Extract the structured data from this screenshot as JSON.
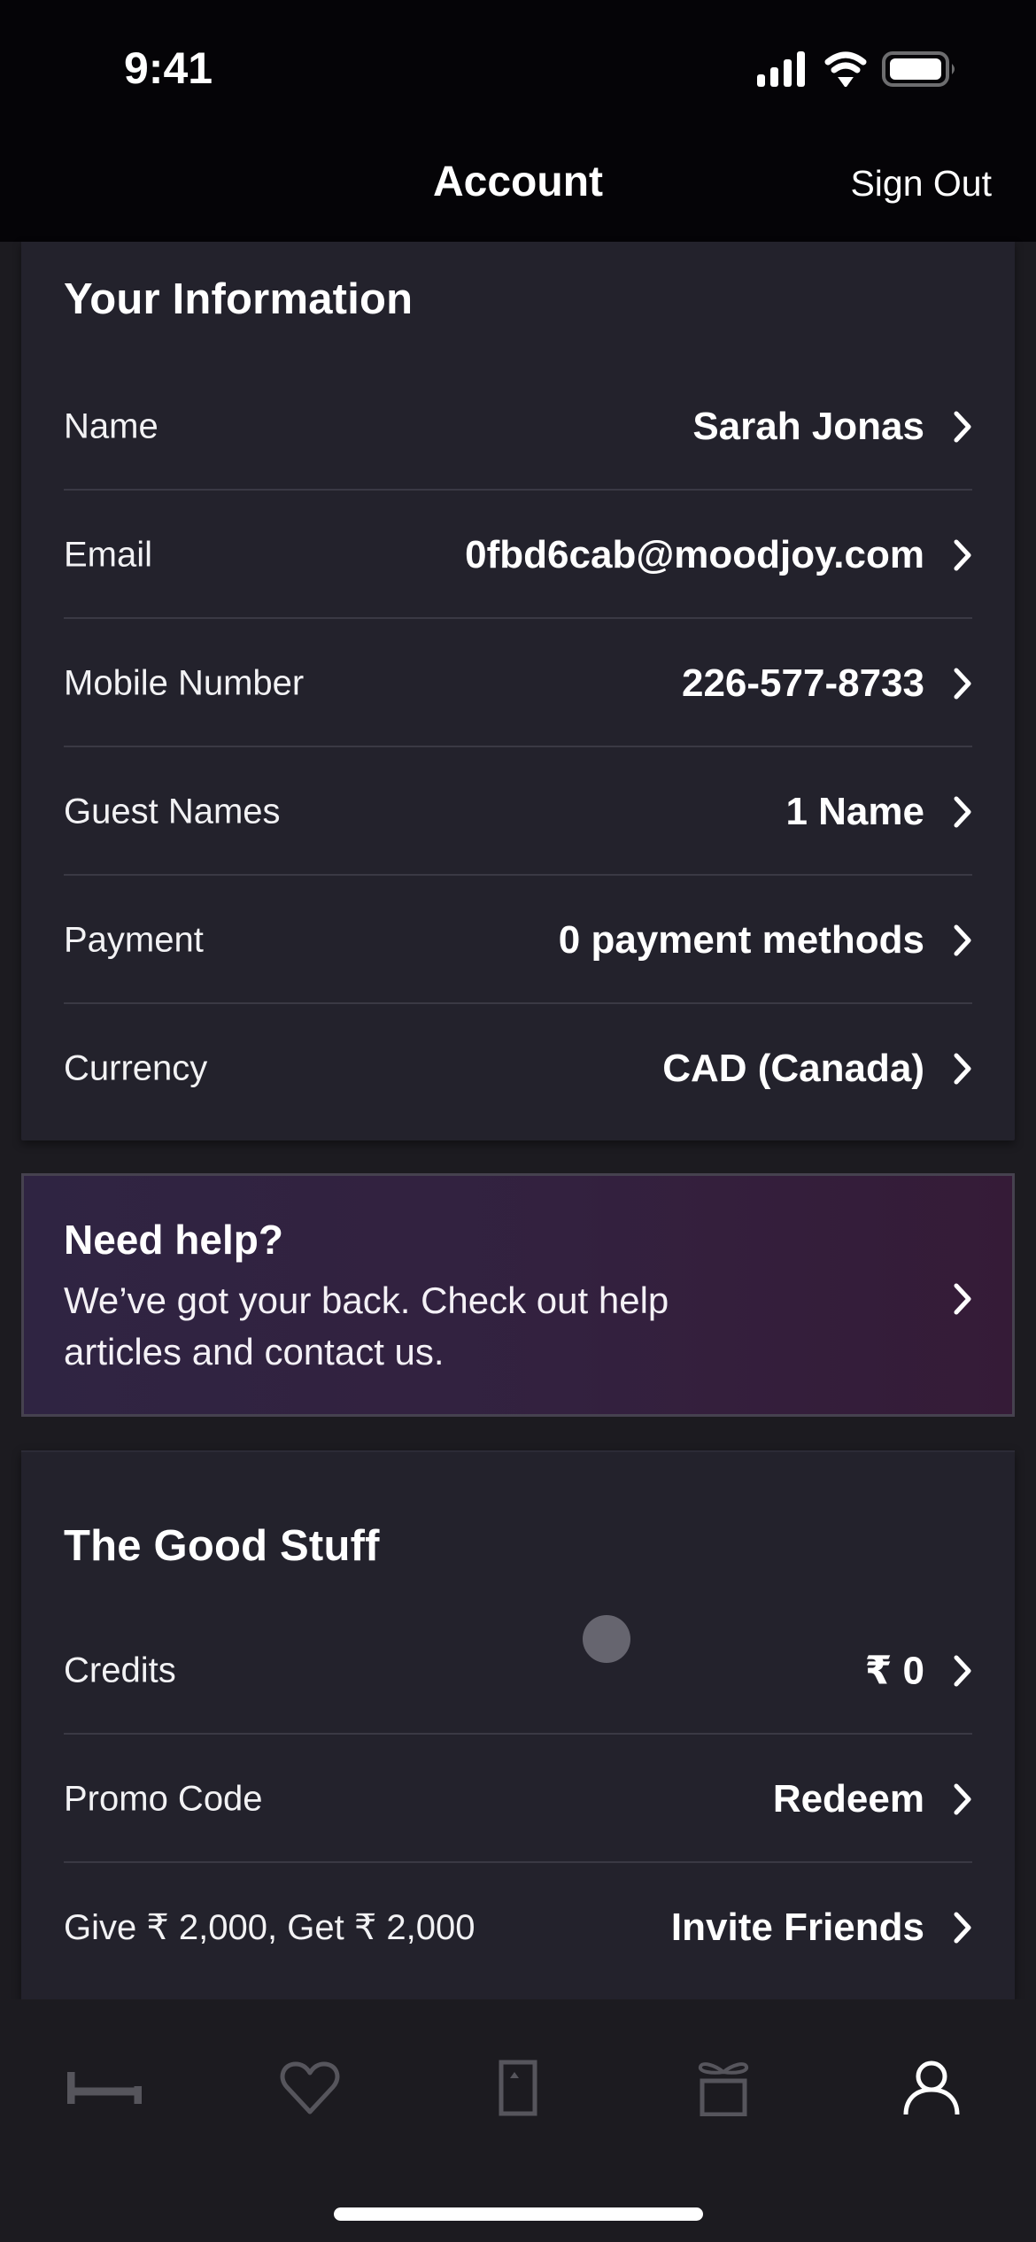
{
  "status_bar": {
    "time": "9:41",
    "icons": [
      "cellular-signal-icon",
      "wifi-icon",
      "battery-icon"
    ]
  },
  "nav": {
    "title": "Account",
    "sign_out_label": "Sign Out"
  },
  "your_information": {
    "title": "Your Information",
    "rows": [
      {
        "label": "Name",
        "value": "Sarah Jonas"
      },
      {
        "label": "Email",
        "value": "0fbd6cab@moodjoy.com"
      },
      {
        "label": "Mobile Number",
        "value": "226-577-8733"
      },
      {
        "label": "Guest Names",
        "value": "1 Name"
      },
      {
        "label": "Payment",
        "value": "0 payment methods"
      },
      {
        "label": "Currency",
        "value": "CAD (Canada)"
      }
    ]
  },
  "help": {
    "title": "Need help?",
    "body": "We’ve got your back. Check out help articles and contact us."
  },
  "good_stuff": {
    "title": "The Good Stuff",
    "rows": [
      {
        "label": "Credits",
        "value": "₹ 0"
      },
      {
        "label": "Promo Code",
        "value": "Redeem"
      },
      {
        "label": "Give ₹ 2,000, Get ₹ 2,000",
        "value": "Invite Friends"
      }
    ]
  },
  "tab_bar": {
    "tabs": [
      {
        "icon": "bed-icon",
        "active": false
      },
      {
        "icon": "heart-icon",
        "active": false
      },
      {
        "icon": "booking-door-icon",
        "active": false
      },
      {
        "icon": "gift-icon",
        "active": false
      },
      {
        "icon": "person-icon",
        "active": true
      }
    ],
    "active_color": "#ffffff",
    "inactive_color": "#56555c"
  },
  "colors": {
    "page_background": "#1c1b20",
    "header_background": "#050407",
    "card_background": "#23222c",
    "help_gradient_start": "#2f2442",
    "help_gradient_end": "#351b37"
  }
}
